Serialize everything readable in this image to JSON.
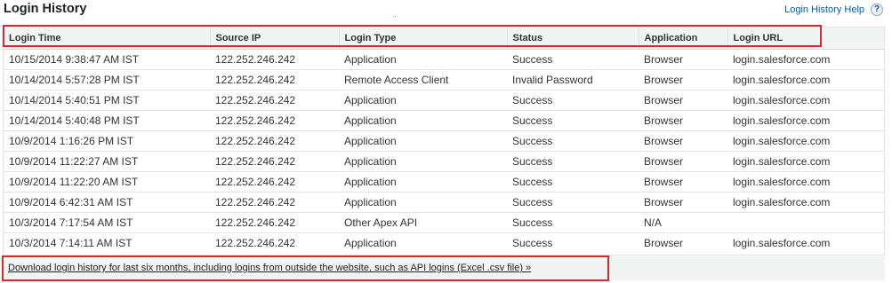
{
  "page": {
    "title": "Login History",
    "help_label": "Login History Help",
    "help_icon": "?"
  },
  "table": {
    "columns": [
      "Login Time",
      "Source IP",
      "Login Type",
      "Status",
      "Application",
      "Login URL"
    ],
    "rows": [
      [
        "10/15/2014 9:38:47 AM IST",
        "122.252.246.242",
        "Application",
        "Success",
        "Browser",
        "login.salesforce.com"
      ],
      [
        "10/14/2014 5:57:28 PM IST",
        "122.252.246.242",
        "Remote Access Client",
        "Invalid Password",
        "Browser",
        "login.salesforce.com"
      ],
      [
        "10/14/2014 5:40:51 PM IST",
        "122.252.246.242",
        "Application",
        "Success",
        "Browser",
        "login.salesforce.com"
      ],
      [
        "10/14/2014 5:40:48 PM IST",
        "122.252.246.242",
        "Application",
        "Success",
        "Browser",
        "login.salesforce.com"
      ],
      [
        "10/9/2014 1:16:26 PM IST",
        "122.252.246.242",
        "Application",
        "Success",
        "Browser",
        "login.salesforce.com"
      ],
      [
        "10/9/2014 11:22:27 AM IST",
        "122.252.246.242",
        "Application",
        "Success",
        "Browser",
        "login.salesforce.com"
      ],
      [
        "10/9/2014 11:22:20 AM IST",
        "122.252.246.242",
        "Application",
        "Success",
        "Browser",
        "login.salesforce.com"
      ],
      [
        "10/9/2014 6:42:31 AM IST",
        "122.252.246.242",
        "Application",
        "Success",
        "Browser",
        "login.salesforce.com"
      ],
      [
        "10/3/2014 7:17:54 AM IST",
        "122.252.246.242",
        "Other Apex API",
        "Success",
        "N/A",
        ""
      ],
      [
        "10/3/2014 7:14:11 AM IST",
        "122.252.246.242",
        "Application",
        "Success",
        "Browser",
        "login.salesforce.com"
      ]
    ]
  },
  "download": {
    "label": "Download login history for last six months, including logins from outside the website, such as API logins (Excel .csv file) »"
  },
  "colors": {
    "highlight": "#d9282f",
    "link": "#015ba7",
    "header_bg": "#f2f3f3"
  }
}
